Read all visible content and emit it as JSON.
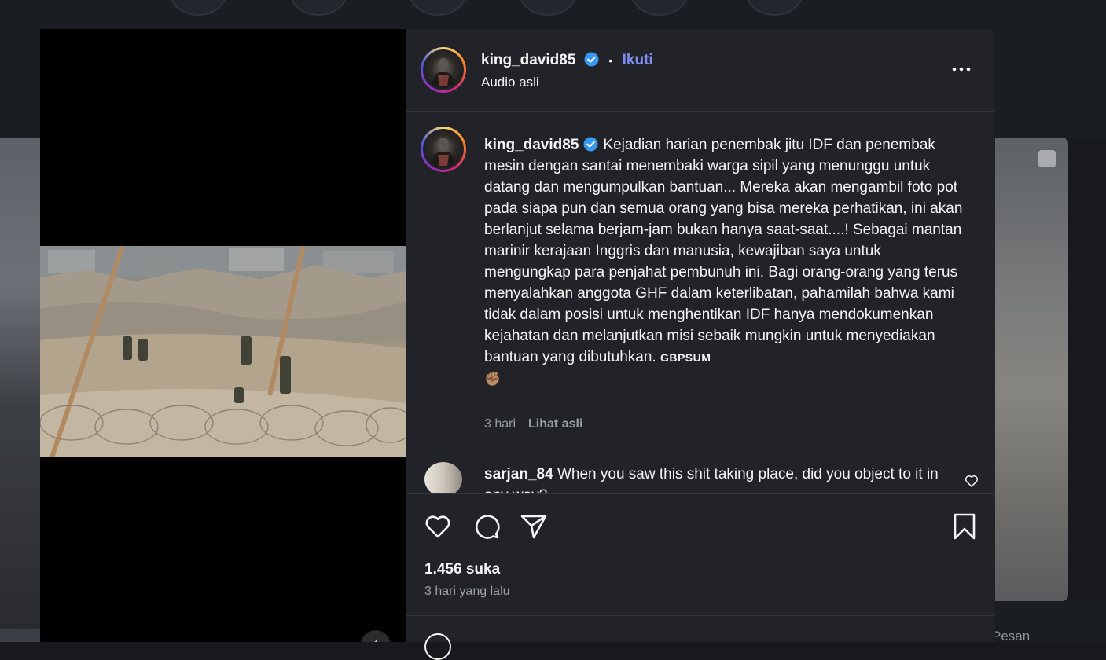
{
  "post": {
    "username": "king_david85",
    "follow_label": "Ikuti",
    "audio_label": "Audio asli",
    "caption": {
      "username": "king_david85",
      "text": "Kejadian harian penembak jitu IDF dan penembak mesin dengan santai menembaki warga sipil yang menunggu untuk datang dan mengumpulkan bantuan... Mereka akan mengambil foto pot pada siapa pun dan semua orang yang bisa mereka perhatikan, ini akan berlanjut selama berjam-jam bukan hanya saat-saat....! Sebagai mantan marinir kerajaan Inggris dan manusia, kewajiban saya untuk mengungkap para penjahat pembunuh ini. Bagi orang-orang yang terus menyalahkan anggota GHF dalam keterlibatan, pahamilah bahwa kami tidak dalam posisi untuk menghentikan IDF hanya mendokumenkan kejahatan dan melanjutkan misi sebaik mungkin untuk menyediakan bantuan yang dibutuhkan.",
      "tag": "GBPSUM",
      "emoji": "✊🏽"
    },
    "caption_time": "3 hari",
    "see_original_label": "Lihat asli",
    "comment": {
      "username": "sarjan_84",
      "text": "When you saw this shit taking place, did you object to it in any way?"
    },
    "likes": "1.456 suka",
    "date": "3 hari yang lalu"
  },
  "background": {
    "messages_label": "Pesan"
  },
  "icons": {
    "verified": "verified-badge-icon",
    "more": "more-options-icon",
    "like": "heart-icon",
    "comment": "comment-bubble-icon",
    "share": "send-icon",
    "save": "bookmark-icon",
    "comment_like": "heart-small-icon",
    "emoji": "emoji-icon",
    "mute": "mute-icon"
  },
  "colors": {
    "panel_bg": "#212328",
    "follow": "#7f8df0",
    "verified": "#3897f0",
    "muted_text": "#9aa0a8"
  }
}
